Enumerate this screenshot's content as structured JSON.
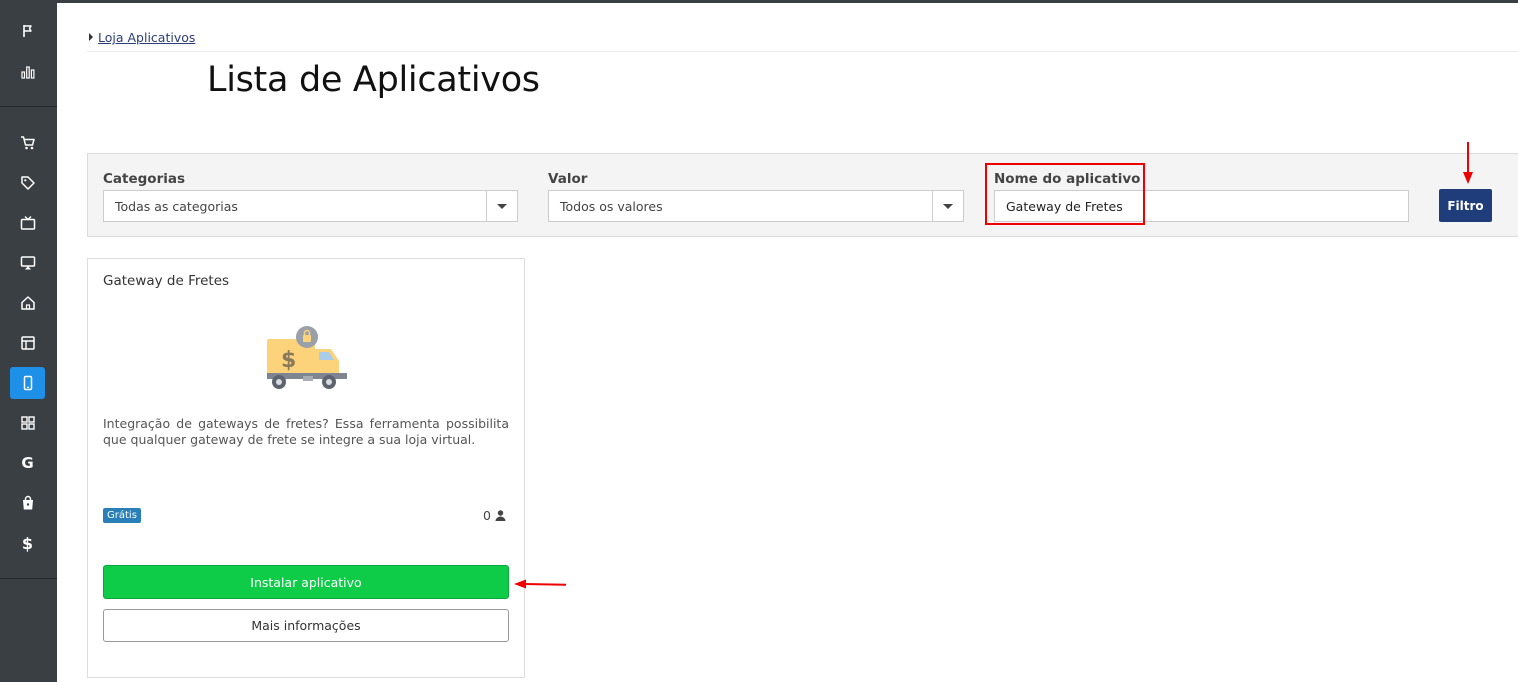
{
  "breadcrumb": {
    "link": "Loja Aplicativos"
  },
  "page": {
    "title": "Lista de Aplicativos"
  },
  "sidebar": {
    "items": [
      {
        "icon": "flag-icon"
      },
      {
        "icon": "bar-chart-icon"
      },
      {
        "icon": "cart-icon"
      },
      {
        "icon": "tag-icon"
      },
      {
        "icon": "tv-icon"
      },
      {
        "icon": "monitor-icon"
      },
      {
        "icon": "home-icon"
      },
      {
        "icon": "layout-icon"
      },
      {
        "icon": "mobile-icon",
        "active": true
      },
      {
        "icon": "grid-icon"
      },
      {
        "icon": "google-icon"
      },
      {
        "icon": "shopping-bag-icon"
      },
      {
        "icon": "dollar-icon"
      }
    ],
    "google_glyph": "G",
    "dollar_glyph": "$"
  },
  "filters": {
    "categories_label": "Categorias",
    "categories_value": "Todas as categorias",
    "value_label": "Valor",
    "value_value": "Todos os valores",
    "name_label": "Nome do aplicativo",
    "name_value": "Gateway de Fretes",
    "filter_button": "Filtro"
  },
  "apps": [
    {
      "title": "Gateway de Fretes",
      "description": "Integração de gateways de fretes? Essa ferramenta possibilita que qualquer gateway de frete se integre a sua loja virtual.",
      "badge": "Grátis",
      "users": "0",
      "install_label": "Instalar aplicativo",
      "more_label": "Mais informações"
    }
  ],
  "colors": {
    "sidebar": "#3a3f44",
    "active": "#1e90e8",
    "filter_button": "#1f3c7b",
    "install_button": "#0ecc48",
    "badge": "#2980b9",
    "annotation": "#e00000"
  }
}
